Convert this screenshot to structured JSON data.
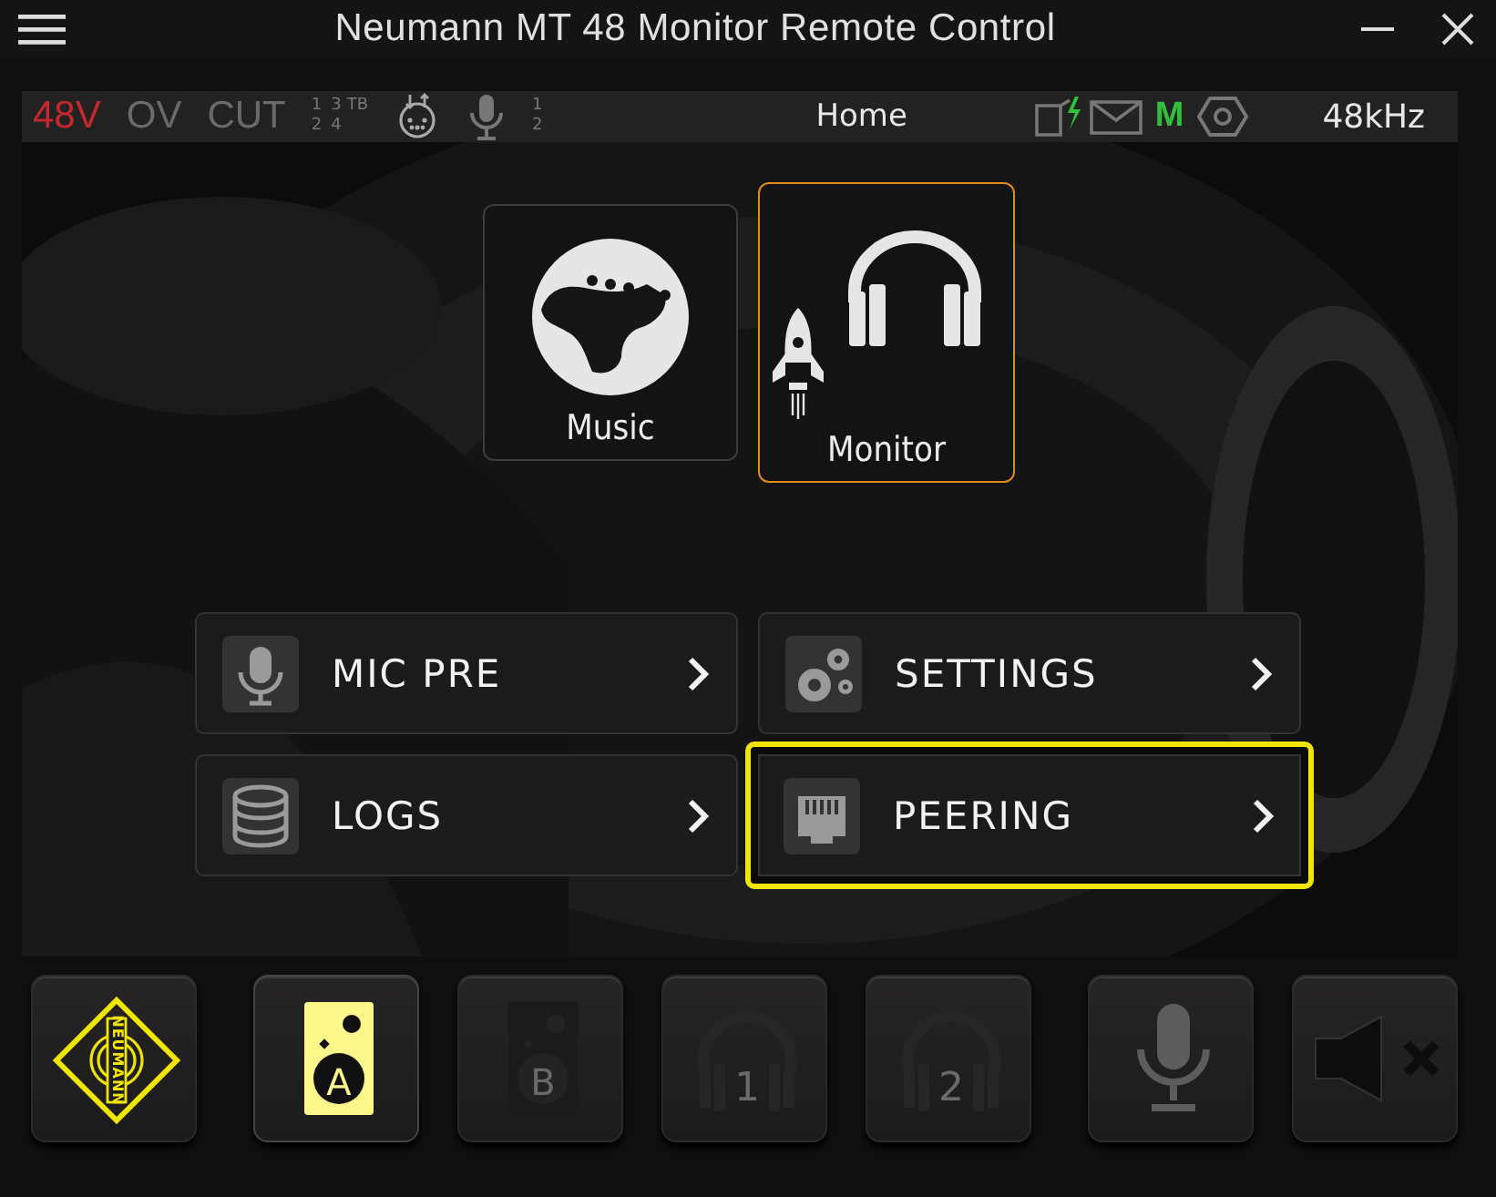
{
  "window": {
    "title": "Neumann MT 48 Monitor Remote Control"
  },
  "status_bar": {
    "indicators": [
      {
        "label": "48V",
        "on": true
      },
      {
        "label": "OV",
        "on": false
      },
      {
        "label": "CUT",
        "on": false
      }
    ],
    "cut_channels": [
      "1",
      "3",
      "2",
      "4"
    ],
    "talkback": "TB",
    "mic_channels": [
      "1",
      "2"
    ],
    "page": "Home",
    "mode": {
      "label": "M",
      "on": true
    },
    "sample_rate": "48kHz"
  },
  "tiles": [
    {
      "label": "Music",
      "kind": "guitar",
      "selected": false
    },
    {
      "label": "Monitor",
      "kind": "monitor",
      "selected": true
    }
  ],
  "menu": [
    {
      "label": "MIC PRE",
      "kind": "mic",
      "selected": false
    },
    {
      "label": "SETTINGS",
      "kind": "gears",
      "selected": false
    },
    {
      "label": "LOGS",
      "kind": "database",
      "selected": false
    },
    {
      "label": "PEERING",
      "kind": "network",
      "selected": true
    }
  ],
  "dock": [
    {
      "kind": "logo",
      "text": "NEUMANN"
    },
    {
      "kind": "speaker",
      "text": "A",
      "active": true
    },
    {
      "kind": "speaker",
      "text": "B",
      "active": false
    },
    {
      "kind": "headphones",
      "text": "1",
      "active": false
    },
    {
      "kind": "headphones",
      "text": "2",
      "active": false
    },
    {
      "kind": "mic"
    },
    {
      "kind": "mute"
    }
  ]
}
